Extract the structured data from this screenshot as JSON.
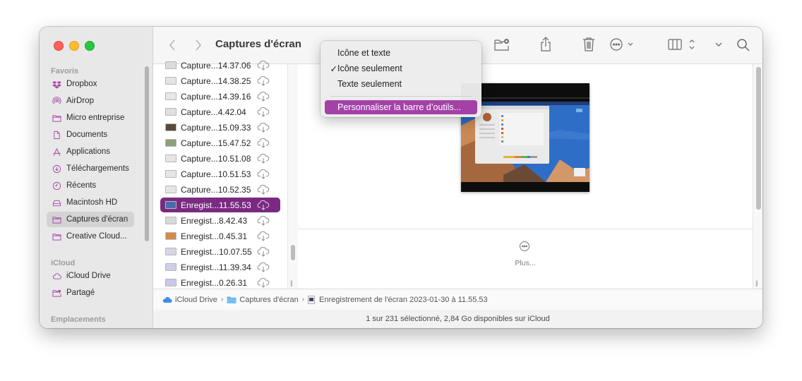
{
  "window": {
    "title": "Captures d'écran"
  },
  "sidebar": {
    "sections": [
      {
        "header": "Favoris",
        "items": [
          {
            "label": "Dropbox",
            "icon": "dropbox-icon"
          },
          {
            "label": "AirDrop",
            "icon": "airdrop-icon"
          },
          {
            "label": "Micro entreprise",
            "icon": "folder-icon"
          },
          {
            "label": "Documents",
            "icon": "document-icon"
          },
          {
            "label": "Applications",
            "icon": "applications-icon"
          },
          {
            "label": "Téléchargements",
            "icon": "download-icon"
          },
          {
            "label": "Récents",
            "icon": "clock-icon"
          },
          {
            "label": "Macintosh HD",
            "icon": "disk-icon"
          },
          {
            "label": "Captures d'écran",
            "icon": "folder-icon",
            "active": true
          },
          {
            "label": "Creative Cloud...",
            "icon": "folder-icon"
          }
        ]
      },
      {
        "header": "iCloud",
        "items": [
          {
            "label": "iCloud Drive",
            "icon": "cloud-icon"
          },
          {
            "label": "Partagé",
            "icon": "shared-folder-icon"
          }
        ]
      },
      {
        "header": "Emplacements",
        "items": []
      }
    ]
  },
  "toolbar": {
    "back_icon": "chevron-left-icon",
    "forward_icon": "chevron-right-icon",
    "icons": [
      "new-folder-icon",
      "share-icon",
      "trash-icon",
      "more-actions-icon",
      "column-view-icon",
      "group-icon",
      "search-icon"
    ]
  },
  "files": [
    {
      "name": "Capture...14.37.06",
      "partial": true
    },
    {
      "name": "Capture...14.38.25"
    },
    {
      "name": "Capture...14.39.16"
    },
    {
      "name": "Capture...4.42.04"
    },
    {
      "name": "Capture...15.09.33"
    },
    {
      "name": "Capture...15.47.52"
    },
    {
      "name": "Capture...10.51.08"
    },
    {
      "name": "Capture...10.51.53"
    },
    {
      "name": "Capture...10.52.35"
    },
    {
      "name": "Enregist...11.55.53",
      "selected": true
    },
    {
      "name": "Enregist...8.42.43"
    },
    {
      "name": "Enregist...0.45.31"
    },
    {
      "name": "Enregist...10.07.55"
    },
    {
      "name": "Enregist...11.39.34"
    },
    {
      "name": "Enregist...0.26.31"
    }
  ],
  "preview": {
    "more_label": "Plus..."
  },
  "context_menu": {
    "items": [
      {
        "label": "Icône et texte",
        "checked": false
      },
      {
        "label": "Icône seulement",
        "checked": true
      },
      {
        "label": "Texte seulement",
        "checked": false
      }
    ],
    "customize_label": "Personnaliser la barre d’outils...",
    "check_glyph": "✓"
  },
  "pathbar": {
    "segments": [
      {
        "label": "iCloud Drive",
        "icon": "icloud-icon"
      },
      {
        "label": "Captures d'écran",
        "icon": "folder-icon"
      },
      {
        "label": "Enregistrement de l'écran 2023-01-30 à 11.55.53",
        "icon": "movie-file-icon"
      }
    ],
    "separator": "›"
  },
  "status": {
    "text": "1 sur 231 sélectionné, 2,84 Go disponibles sur iCloud"
  },
  "colors": {
    "accent": "#a441a8",
    "selection": "#7a2a82"
  }
}
